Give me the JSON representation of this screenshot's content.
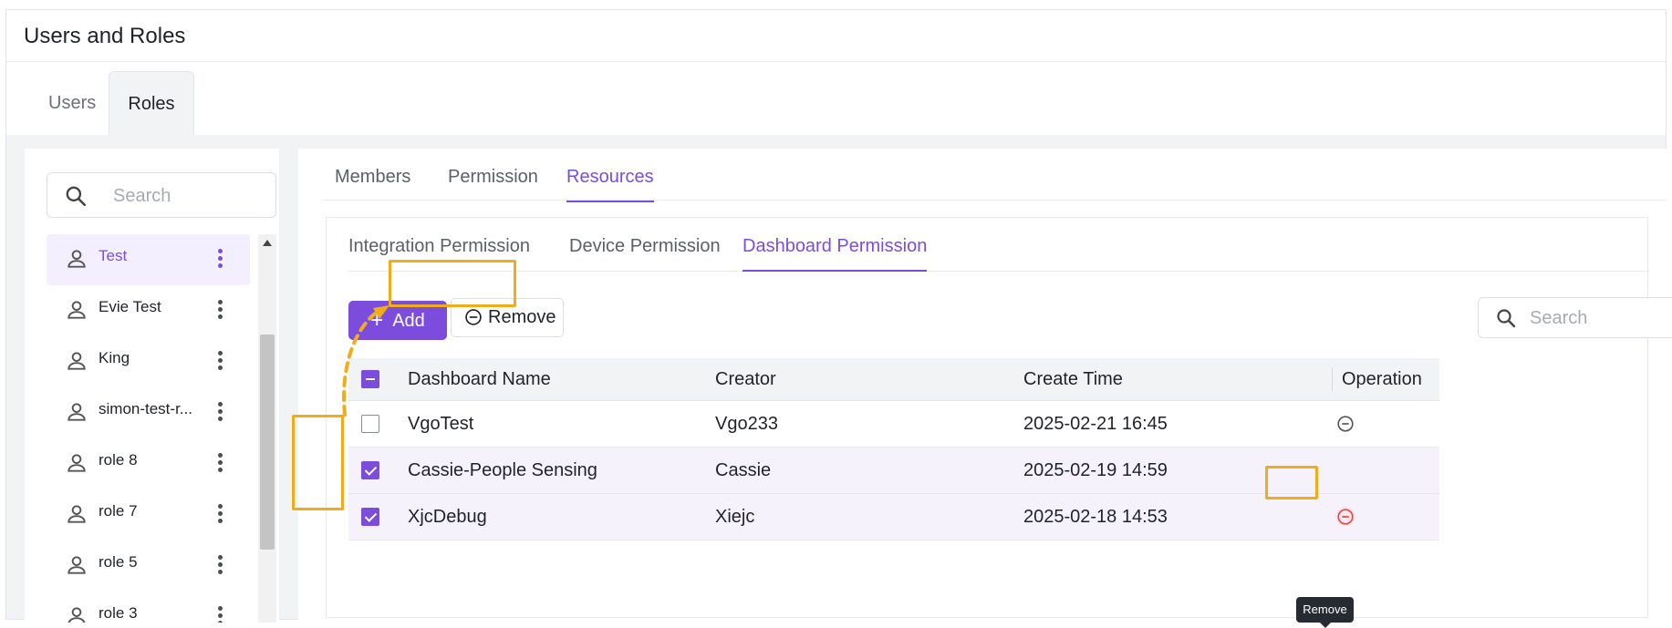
{
  "header": {
    "title": "Users and Roles"
  },
  "top_tabs": [
    {
      "label": "Users"
    },
    {
      "label": "Roles"
    }
  ],
  "role_search": {
    "placeholder": "Search"
  },
  "roles": [
    {
      "name": "Test"
    },
    {
      "name": "Evie Test"
    },
    {
      "name": "King"
    },
    {
      "name": "simon-test-r..."
    },
    {
      "name": "role 8"
    },
    {
      "name": "role 7"
    },
    {
      "name": "role 5"
    },
    {
      "name": "role 3"
    }
  ],
  "section_tabs": [
    {
      "label": "Members"
    },
    {
      "label": "Permission"
    },
    {
      "label": "Resources"
    }
  ],
  "resource_tabs": [
    {
      "label": "Integration Permission"
    },
    {
      "label": "Device Permission"
    },
    {
      "label": "Dashboard Permission"
    }
  ],
  "toolbar": {
    "add_label": "Add",
    "remove_label": "Remove",
    "search_placeholder": "Search"
  },
  "table": {
    "columns": [
      "Dashboard Name",
      "Creator",
      "Create Time",
      "Operation"
    ],
    "rows": [
      {
        "name": "VgoTest",
        "creator": "Vgo233",
        "time": "2025-02-21 16:45",
        "checked": false
      },
      {
        "name": "Cassie-People Sensing",
        "creator": "Cassie",
        "time": "2025-02-19 14:59",
        "checked": true
      },
      {
        "name": "XjcDebug",
        "creator": "Xiejc",
        "time": "2025-02-18 14:53",
        "checked": true
      }
    ]
  },
  "tooltip": {
    "text": "Remove"
  },
  "colors": {
    "accent": "#7c4ddd",
    "highlight": "#f0ad1b",
    "danger": "#e5484d"
  }
}
